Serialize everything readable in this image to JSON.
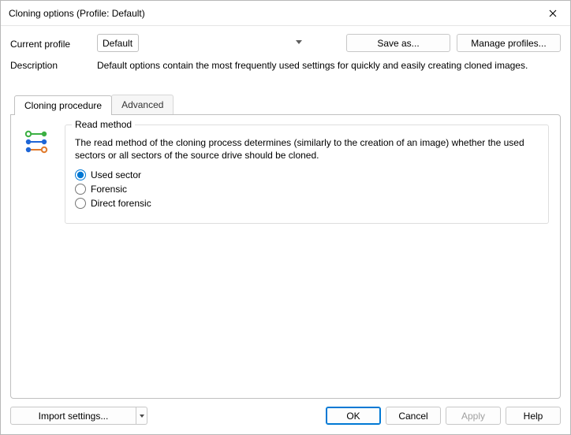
{
  "window": {
    "title": "Cloning options (Profile: Default)"
  },
  "header": {
    "profile_label": "Current profile",
    "profile_value": "Default",
    "save_as_label": "Save as...",
    "manage_label": "Manage profiles...",
    "description_label": "Description",
    "description_text": "Default options contain the most frequently used settings for quickly and easily creating cloned images."
  },
  "tabs": {
    "cloning": "Cloning procedure",
    "advanced": "Advanced"
  },
  "read_method": {
    "legend": "Read method",
    "help": "The read method of the cloning process determines (similarly to the creation of an image) whether the used sectors or all sectors of the source drive should be cloned.",
    "opt_used": "Used sector",
    "opt_forensic": "Forensic",
    "opt_direct": "Direct forensic"
  },
  "footer": {
    "import_label": "Import settings...",
    "ok": "OK",
    "cancel": "Cancel",
    "apply": "Apply",
    "help": "Help"
  }
}
